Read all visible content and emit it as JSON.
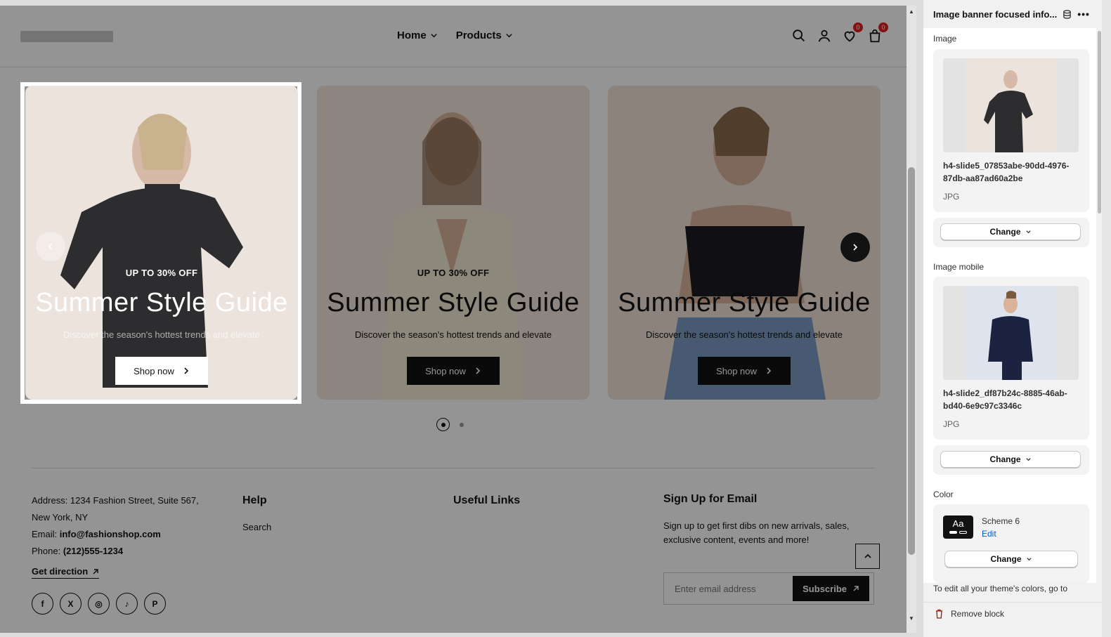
{
  "header": {
    "nav": [
      {
        "label": "Home"
      },
      {
        "label": "Products"
      }
    ],
    "wishlist_count": "0",
    "cart_count": "0"
  },
  "slides": [
    {
      "eyebrow": "UP TO 30% OFF",
      "title": "Summer Style Guide",
      "description": "Discover the season's hottest trends and elevate",
      "button": "Shop now",
      "bg": "#ece4dc"
    },
    {
      "eyebrow": "UP TO 30% OFF",
      "title": "Summer Style Guide",
      "description": "Discover the season's hottest trends and elevate",
      "button": "Shop now",
      "bg": "#f2e6dc"
    },
    {
      "eyebrow": "",
      "title": "Summer Style Guide",
      "description": "Discover the season's hottest trends and elevate",
      "button": "Shop now",
      "bg": "#f0e2d6"
    }
  ],
  "footer": {
    "address_line1": "Address: 1234 Fashion Street, Suite 567,",
    "address_line2": "New York, NY",
    "email_label": "Email: ",
    "email": "info@fashionshop.com",
    "phone_label": "Phone: ",
    "phone": "(212)555-1234",
    "get_direction": "Get direction",
    "help_heading": "Help",
    "help_link": "Search",
    "useful_heading": "Useful Links",
    "signup_heading": "Sign Up for Email",
    "signup_text": "Sign up to get first dibs on new arrivals, sales, exclusive content, events and more!",
    "email_placeholder": "Enter email address",
    "subscribe": "Subscribe",
    "social": [
      "f",
      "X",
      "◎",
      "♪",
      "P"
    ]
  },
  "panel": {
    "title": "Image banner focused info...",
    "image_label": "Image",
    "image_name": "h4-slide5_07853abe-90dd-4976-87db-aa87ad60a2be",
    "image_type": "JPG",
    "change": "Change",
    "image_mobile_label": "Image mobile",
    "image_mobile_name": "h4-slide2_df87b24c-8885-46ab-bd40-6e9c97c3346c",
    "image_mobile_type": "JPG",
    "color_label": "Color",
    "scheme_name": "Scheme 6",
    "scheme_edit": "Edit",
    "aa": "Aa",
    "footer_note": "To edit all your theme's colors, go to",
    "remove_block": "Remove block"
  },
  "colors": {
    "accent_dark": "#121212",
    "remove_red": "#8e1f0b",
    "badge_red": "#e02020"
  }
}
